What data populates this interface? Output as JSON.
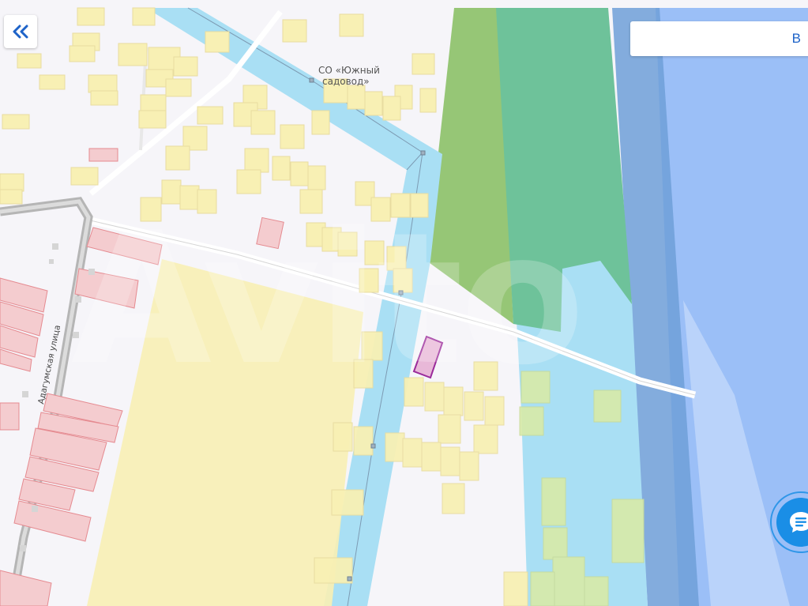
{
  "map": {
    "labels": {
      "snt_line1": "СО «Южный",
      "snt_line2": "садовод»",
      "street": "Адагумская улица"
    },
    "watermark": "Avito"
  },
  "controls": {
    "collapse_icon": "double-chevron-left-icon",
    "search_partial_text": "В",
    "chat_icon": "chat-icon"
  },
  "colors": {
    "water_lake": "#9bbff7",
    "water_channel": "#a9dff4",
    "forest_light": "#96c676",
    "forest_dark": "#6ec29a",
    "parcel_yellow": "#f8f0b4",
    "parcel_red": "#f4cccf",
    "selected_parcel": "#e8b8d8",
    "accent": "#1e63c8"
  }
}
